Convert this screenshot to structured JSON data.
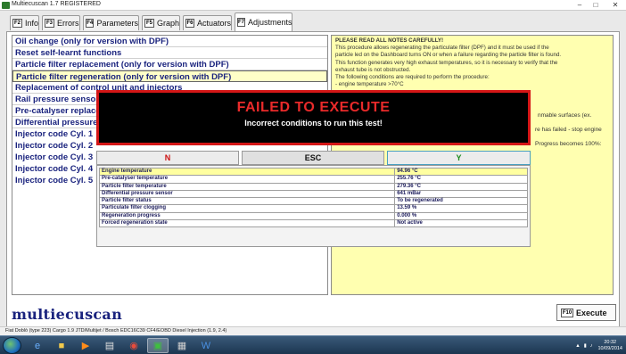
{
  "window": {
    "title": "Multiecuscan 1.7 REGISTERED",
    "controls": {
      "minimize": "–",
      "maximize": "□",
      "close": "✕"
    }
  },
  "tabs": [
    {
      "key": "F2",
      "label": "Info"
    },
    {
      "key": "F3",
      "label": "Errors"
    },
    {
      "key": "F4",
      "label": "Parameters"
    },
    {
      "key": "F5",
      "label": "Graph"
    },
    {
      "key": "F6",
      "label": "Actuators"
    },
    {
      "key": "F7",
      "label": "Adjustments"
    }
  ],
  "adjustments": [
    "Oil change (only for version with DPF)",
    "Reset self-learnt functions",
    "Particle filter replacement (only for version with DPF)",
    "Particle filter regeneration (only for version with DPF)",
    "Replacement of control unit and injectors",
    "Rail pressure sensor",
    "Pre-catalyser replace",
    "Differential pressure",
    "Injector code Cyl. 1",
    "Injector code Cyl. 2",
    "Injector code Cyl. 3",
    "Injector code Cyl. 4",
    "Injector code Cyl. 5"
  ],
  "notes": {
    "heading": "PLEASE READ ALL NOTES CAREFULLY!",
    "lines": [
      "This procedure allows regenerating the particulate filter (DPF) and it must be used if the",
      "particle led on the Dashboard turns ON or when a failure regarding the particle filter is found.",
      "This function generates very high exhaust temperatures, so it is necessary to verify that the",
      "exhaust tube is not obstructed.",
      "The following conditions are required to perform the procedure:",
      "- engine temperature >70°C"
    ],
    "fragments": {
      "flammable": "nmable surfaces (ex.",
      "failed": "re has failed - stop engine",
      "progress": "Progress becomes 100%:"
    }
  },
  "modal": {
    "title": "FAILED TO EXECUTE",
    "message": "Incorrect conditions to run this test!",
    "buttons": {
      "no": "N",
      "esc": "ESC",
      "yes": "Y"
    }
  },
  "parameters": [
    {
      "name": "Engine temperature",
      "value": "94.96 °C"
    },
    {
      "name": "Pre-catalyser temperature",
      "value": "255.76 °C"
    },
    {
      "name": "Particle filter temperature",
      "value": "279.36 °C"
    },
    {
      "name": "Differential pressure sensor",
      "value": "641 mBar"
    },
    {
      "name": "Particle filter status",
      "value": "To be regenerated"
    },
    {
      "name": "Particulate filter clogging",
      "value": "13.59 %"
    },
    {
      "name": "Regeneration progress",
      "value": "0.000 %"
    },
    {
      "name": "Forced regeneration state",
      "value": "Not active"
    }
  ],
  "logo": "multiecuscan",
  "execute": {
    "key": "F10",
    "label": "Execute"
  },
  "status_bar": "Fiat Doblò (type 223) Cargo 1.9 JTD/Multijet / Bosch EDC16C39 CF4/EOBD Diesel Injection (1.9, 2.4)",
  "taskbar": {
    "time": "20:32",
    "date": "10/09/2014"
  },
  "colors": {
    "accent": "#1a237e",
    "error": "#d41616",
    "notes_bg": "#ffffb0",
    "selection": "#ffffc8"
  }
}
